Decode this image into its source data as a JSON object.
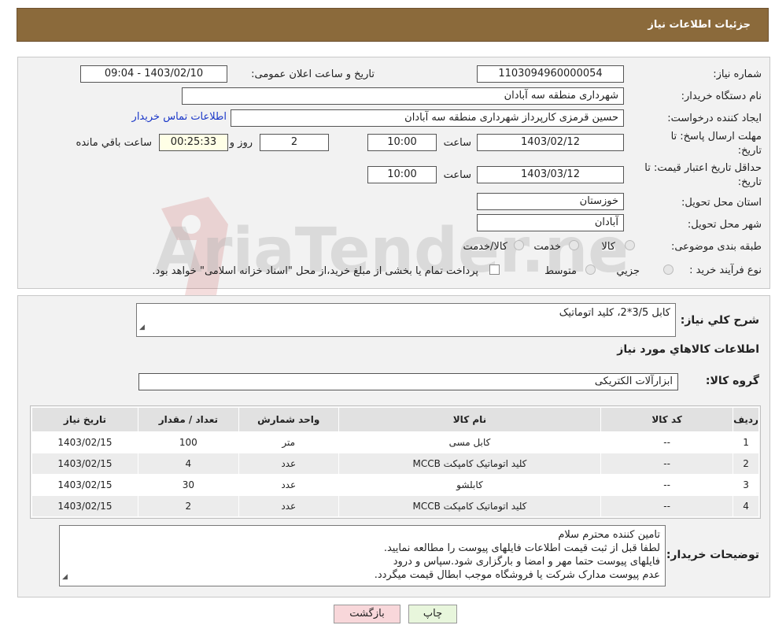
{
  "header": {
    "title": "جزئیات اطلاعات نیاز"
  },
  "form": {
    "need_number": {
      "label": "شماره نیاز:",
      "value": "1103094960000054"
    },
    "announce_datetime": {
      "label": "تاریخ و ساعت اعلان عمومی:",
      "value": "1403/02/10 - 09:04"
    },
    "buyer_org": {
      "label": "نام دستگاه خریدار:",
      "value": "شهرداری منطقه سه آبادان"
    },
    "requester": {
      "label": "ایجاد کننده درخواست:",
      "value": "حسین قرمزی کارپرداز شهرداری منطقه سه آبادان"
    },
    "contact_link": "اطلاعات تماس خریدار",
    "reply_deadline": {
      "label_line1": "مهلت ارسال پاسخ: تا",
      "label_line2": "تاریخ:",
      "date": "1403/02/12",
      "time_label": "ساعت",
      "time": "10:00",
      "days": "2",
      "days_label": "روز و",
      "remaining": "00:25:33",
      "remaining_label": "ساعت باقي مانده"
    },
    "price_validity": {
      "label_line1": "حداقل تاریخ اعتبار قیمت: تا",
      "label_line2": "تاریخ:",
      "date": "1403/03/12",
      "time_label": "ساعت",
      "time": "10:00"
    },
    "province": {
      "label": "استان محل تحویل:",
      "value": "خوزستان"
    },
    "city": {
      "label": "شهر محل تحویل:",
      "value": "آبادان"
    },
    "category": {
      "label": "طبقه بندی موضوعی:",
      "options": [
        "کالا",
        "خدمت",
        "کالا/خدمت"
      ]
    },
    "process": {
      "label": "نوع فرآیند خرید :",
      "options": [
        "جزیي",
        "متوسط"
      ],
      "note": "پرداخت تمام یا بخشی از مبلغ خرید،از محل \"اسناد خزانه اسلامی\" خواهد بود."
    }
  },
  "watermark": "AriaTender.neT",
  "summary": {
    "label": "شرح کلي نياز:",
    "value": "کابل 3/5*2، کلید اتوماتیک"
  },
  "goods_info_title": "اطلاعات کالاهاي مورد نياز",
  "goods_group": {
    "label": "گروه کالا:",
    "value": "ابزارآلات الکتریکی"
  },
  "table": {
    "headers": [
      "ردیف",
      "کد کالا",
      "نام کالا",
      "واحد شمارش",
      "تعداد / مقدار",
      "تاریخ نیاز"
    ],
    "rows": [
      [
        "1",
        "--",
        "کابل مسی",
        "متر",
        "100",
        "1403/02/15"
      ],
      [
        "2",
        "--",
        "کلید اتوماتیک کامپکت MCCB",
        "عدد",
        "4",
        "1403/02/15"
      ],
      [
        "3",
        "--",
        "کابلشو",
        "عدد",
        "30",
        "1403/02/15"
      ],
      [
        "4",
        "--",
        "کلید اتوماتیک کامپکت MCCB",
        "عدد",
        "2",
        "1403/02/15"
      ]
    ]
  },
  "buyer_notes": {
    "label": "توضیحات خریدار:",
    "lines": [
      "تامین کننده محترم سلام",
      "لطفا قبل از ثبت قیمت اطلاعات فایلهای پیوست را مطالعه نمایید.",
      "فایلهای پیوست حتما مهر و امضا و بارگزاری شود.سپاس و درود",
      "عدم پیوست مدارک شرکت یا فروشگاه موجب ابطال قیمت میگردد."
    ]
  },
  "buttons": {
    "back": "بازگشت",
    "print": "چاپ"
  }
}
